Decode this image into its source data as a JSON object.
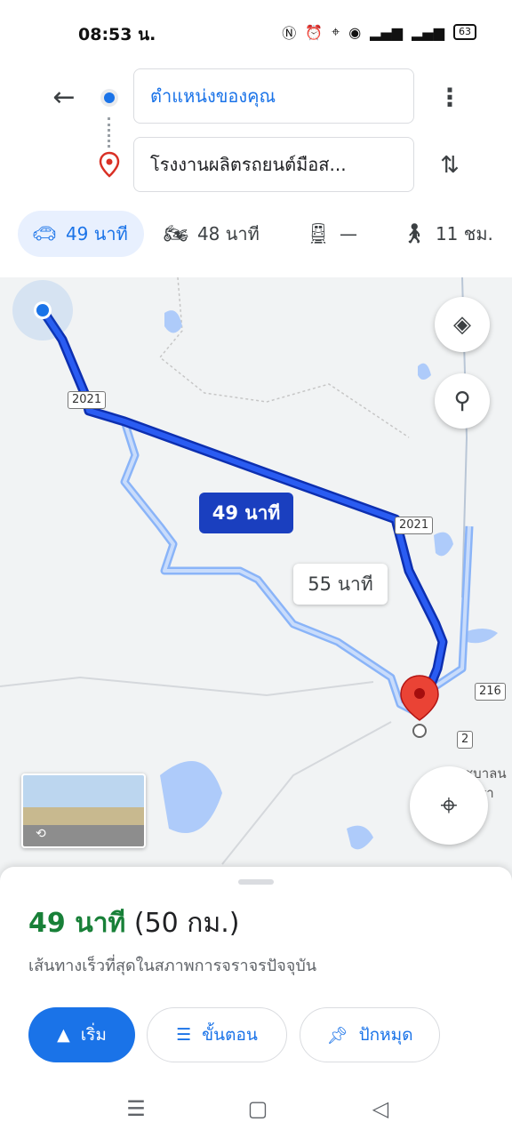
{
  "status_bar": {
    "time": "08:53 น.",
    "battery": "63",
    "icons": [
      "nfc-icon",
      "alarm-icon",
      "location-icon",
      "wifi-icon",
      "volte-icon",
      "signal-icon",
      "signal-icon",
      "battery-icon"
    ]
  },
  "header": {
    "origin": "ตำแหน่งของคุณ",
    "destination": "โรงงานผลิตรถยนต์มือส...",
    "icons": {
      "back": "arrow-left-icon",
      "more": "more-vert-icon",
      "swap": "swap-vert-icon"
    }
  },
  "modes": [
    {
      "label": "49 นาที",
      "icon": "car-icon",
      "active": true
    },
    {
      "label": "48 นาที",
      "icon": "motorcycle-icon",
      "active": false
    },
    {
      "label": "—",
      "icon": "transit-icon",
      "active": false
    },
    {
      "label": "11 ชม.",
      "icon": "walk-icon",
      "active": false
    }
  ],
  "map": {
    "primary_route_label": "49 นาที",
    "alt_route_label": "55 นาที",
    "road_shields": [
      "2021",
      "2021",
      "216",
      "2"
    ],
    "place_text": [
      "ชุบาลน",
      "ธรา"
    ],
    "colors": {
      "primary_route": "#1a3fd4",
      "alt_route": "#8ab4f8",
      "water": "#aecbfa",
      "background": "#f1f3f4"
    }
  },
  "bottom_sheet": {
    "duration": "49 นาที",
    "distance": "(50 กม.)",
    "subtitle": "เส้นทางเร็วที่สุดในสภาพการจราจรปัจจุบัน",
    "buttons": {
      "start": "เริ่ม",
      "steps": "ขั้นตอน",
      "pin": "ปักหมุด"
    }
  }
}
